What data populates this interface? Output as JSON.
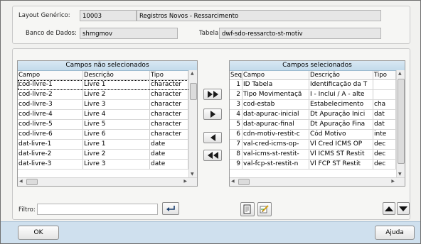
{
  "header": {
    "layout_label": "Layout Genérico:",
    "layout_code": "10003",
    "layout_desc": "Registros Novos - Ressarcimento",
    "db_label": "Banco de Dados:",
    "db_value": "shmgmov",
    "table_label": "Tabela:",
    "table_value": "dwf-sdo-ressarcto-st-motiv"
  },
  "left_grid": {
    "title": "Campos não selecionados",
    "columns": [
      "Campo",
      "Descrição",
      "Tipo"
    ],
    "rows": [
      [
        "cod-livre-1",
        "Livre 1",
        "character"
      ],
      [
        "cod-livre-2",
        "Livre 2",
        "character"
      ],
      [
        "cod-livre-3",
        "Livre 3",
        "character"
      ],
      [
        "cod-livre-4",
        "Livre 4",
        "character"
      ],
      [
        "cod-livre-5",
        "Livre 5",
        "character"
      ],
      [
        "cod-livre-6",
        "Livre 6",
        "character"
      ],
      [
        "dat-livre-1",
        "Livre 1",
        "date"
      ],
      [
        "dat-livre-2",
        "Livre 2",
        "date"
      ],
      [
        "dat-livre-3",
        "Livre 3",
        "date"
      ]
    ]
  },
  "right_grid": {
    "title": "Campos selecionados",
    "columns": [
      "Seq",
      "Campo",
      "Descrição",
      "Tipo"
    ],
    "rows": [
      [
        "1",
        "ID Tabela",
        "Identificação da T",
        ""
      ],
      [
        "2",
        "Tipo Movimentaçã",
        "I - Inclui / A - alte",
        ""
      ],
      [
        "3",
        "cod-estab",
        "Estabelecimento",
        "cha"
      ],
      [
        "4",
        "dat-apurac-inicial",
        "Dt Apuração Inici",
        "dat"
      ],
      [
        "5",
        "dat-apurac-final",
        "Dt Apuração Fina",
        "dat"
      ],
      [
        "6",
        "cdn-motiv-restit-c",
        "Cód Motivo",
        "inte"
      ],
      [
        "7",
        "val-cred-icms-op-",
        "Vl Cred ICMS OP",
        "dec"
      ],
      [
        "8",
        "val-icms-st-restit-",
        "Vl ICMS ST Restit",
        "dec"
      ],
      [
        "9",
        "val-fcp-st-restit-n",
        "Vl FCP ST Restit",
        "dec"
      ]
    ]
  },
  "filter": {
    "label": "Filtro:",
    "value": ""
  },
  "footer": {
    "ok_label": "OK",
    "help_label": "Ajuda"
  },
  "icons": {
    "add_all": "double-right-arrow-icon",
    "add": "right-arrow-icon",
    "remove": "left-arrow-icon",
    "remove_all": "double-left-arrow-icon",
    "apply_filter": "enter-icon",
    "notes": "document-icon",
    "edit": "edit-pencil-icon",
    "move_up": "arrow-up-icon",
    "move_down": "arrow-down-icon"
  }
}
